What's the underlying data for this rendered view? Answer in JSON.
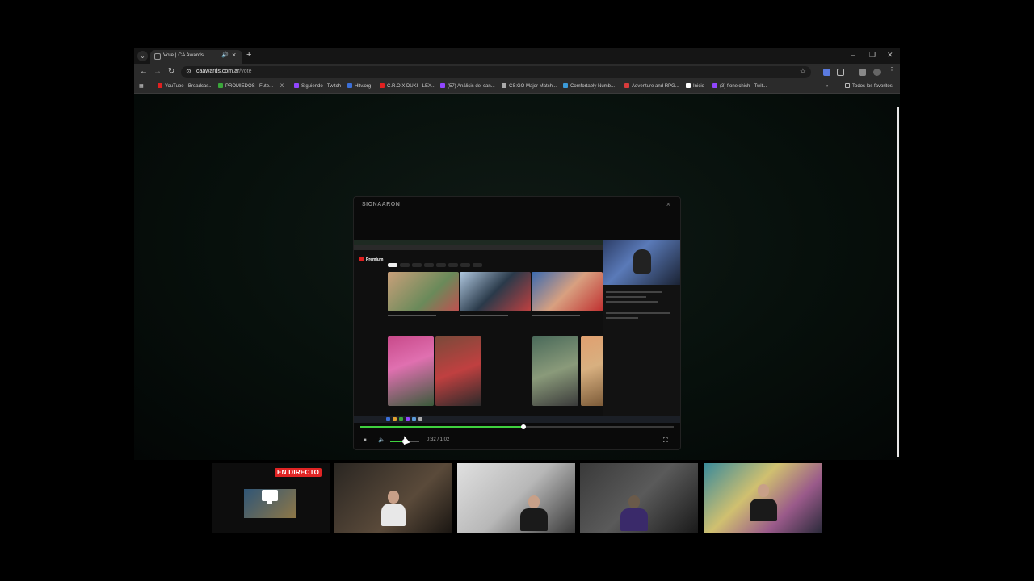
{
  "browser": {
    "tab": {
      "title": "Vote | CA Awards"
    },
    "url": {
      "host": "caawards.com.ar",
      "path": "/vote"
    },
    "bookmarks": [
      {
        "label": "YouTube - Broadcas...",
        "color": "#e02020"
      },
      {
        "label": "PROMIEDOS - Futb...",
        "color": "#3aa63a"
      },
      {
        "label": "X",
        "color": "#ffffff"
      },
      {
        "label": "Siguiendo - Twitch",
        "color": "#9146ff"
      },
      {
        "label": "Hltv.org",
        "color": "#3b6fd8"
      },
      {
        "label": "C.R.O X DUKI - LEX...",
        "color": "#e02020"
      },
      {
        "label": "(57) Análisis del can...",
        "color": "#9146ff"
      },
      {
        "label": "CS:GO Major Match...",
        "color": "#aaaaaa"
      },
      {
        "label": "Comfortably Numb...",
        "color": "#3b9ad8"
      },
      {
        "label": "Adventure and RPG...",
        "color": "#d83b3b"
      },
      {
        "label": "Inicio",
        "color": "#ffffff"
      },
      {
        "label": "(3) fioneichich - Twit...",
        "color": "#9146ff"
      }
    ],
    "all_bookmarks_label": "Todos los favoritos"
  },
  "modal": {
    "title": "SIONAARON",
    "player": {
      "time_text": "0:32 / 1:02",
      "progress_fraction": 0.52,
      "volume_fraction": 0.5,
      "state": "playing"
    },
    "video": {
      "yt_logo": "Premium"
    }
  },
  "camera_strip": {
    "live_label": "EN DIRECTO"
  },
  "colors": {
    "accent_green": "#3fd13f",
    "live_red": "#e02424"
  },
  "icons": {
    "pause": "⏸",
    "volume": "🔈",
    "fullscreen": "⛶"
  }
}
